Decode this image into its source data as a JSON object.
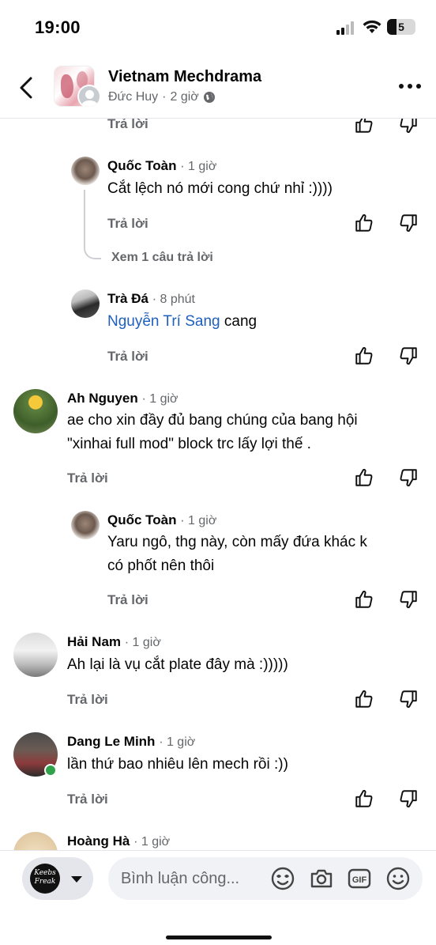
{
  "status_bar": {
    "time": "19:00",
    "battery": "5"
  },
  "header": {
    "title": "Vietnam Mechdrama",
    "author": "Đức Huy",
    "separator": "·",
    "time": "2 giờ"
  },
  "labels": {
    "reply": "Trả lời"
  },
  "comments": [
    {
      "name": "Quốc Toàn",
      "time": "· 1 giờ",
      "text": "Cắt lệch nó mới cong chứ nhỉ :))))"
    },
    {
      "view_replies": "Xem 1 câu trả lời"
    },
    {
      "name": "Trà Đá",
      "time": "· 8 phút",
      "mention": "Nguyễn Trí Sang",
      "text": " cang"
    },
    {
      "name": "Ah Nguyen",
      "time": "· 1 giờ",
      "text_lines": [
        "ae cho xin đầy đủ bang chúng của bang hội",
        "\"xinhai full mod\" block trc lấy lợi thế ."
      ]
    },
    {
      "name": "Quốc Toàn",
      "time": "· 1 giờ",
      "text_lines": [
        "Yaru ngô, thg này, còn mấy đứa khác k",
        "có phốt nên thôi"
      ]
    },
    {
      "name": "Hải Nam",
      "time": "· 1 giờ",
      "text": "Ah lại là vụ cắt plate đây mà :)))))"
    },
    {
      "name": "Dang Le Minh",
      "time": "· 1 giờ",
      "text": "lần thứ bao nhiêu lên mech rồi :))"
    },
    {
      "name": "Hoàng Hà",
      "time": "· 1 giờ"
    }
  ],
  "composer": {
    "account_logo": "Keebs Freak",
    "placeholder": "Bình luận công..."
  },
  "icons": {
    "back": "chevron-left-icon",
    "more": "more-horizontal-icon",
    "privacy": "globe-icon",
    "like": "thumbs-up-icon",
    "dislike": "thumbs-down-icon",
    "avatar_sticker": "avatar-sticker-icon",
    "camera": "camera-icon",
    "gif": "gif-icon",
    "emoji": "emoji-icon"
  }
}
